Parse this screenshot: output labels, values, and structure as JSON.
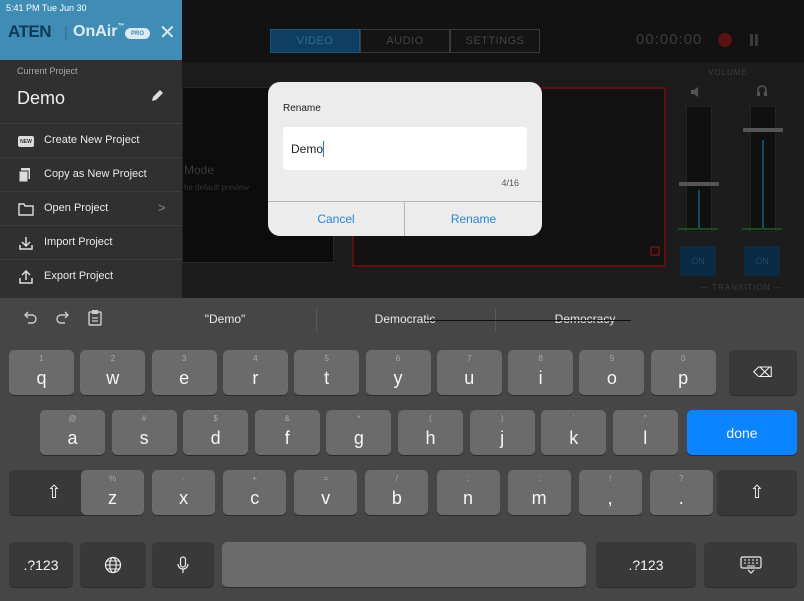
{
  "status_bar": {
    "time": "5:41 PM  Tue Jun 30"
  },
  "app_header": {
    "logo": "ATEN",
    "separator": "|",
    "product": "OnAir",
    "tm": "™",
    "pro_badge": "PRO",
    "close_glyph": "✕",
    "tabs": [
      {
        "label": "VIDEO",
        "active": true
      },
      {
        "label": "AUDIO",
        "active": false
      },
      {
        "label": "SETTINGS",
        "active": false
      }
    ],
    "timer": "00:00:00"
  },
  "sidebar": {
    "current_label": "Current Project",
    "project_name": "Demo",
    "items": [
      {
        "label": "Create New Project",
        "icon": "new-badge-icon",
        "badge": "NEW"
      },
      {
        "label": "Copy as New Project",
        "icon": "copy-icon"
      },
      {
        "label": "Open Project",
        "icon": "folder-icon",
        "chevron": ">"
      },
      {
        "label": "Import Project",
        "icon": "import-icon"
      },
      {
        "label": "Export Project",
        "icon": "export-icon"
      }
    ]
  },
  "background": {
    "mode_text": "Mode",
    "mode_sub": "he default preview",
    "volume_label": "VOLUME",
    "transition_label": "— TRANSITION —",
    "on_left": "ON",
    "on_right": "ON"
  },
  "dialog": {
    "title": "Rename",
    "input_value": "Demo",
    "char_count": "4/16",
    "cancel_label": "Cancel",
    "rename_label": "Rename"
  },
  "keyboard": {
    "predictions": [
      "\"Demo\"",
      "Democratic",
      "Democracy"
    ],
    "row1": [
      {
        "hint": "1",
        "key": "q"
      },
      {
        "hint": "2",
        "key": "w"
      },
      {
        "hint": "3",
        "key": "e"
      },
      {
        "hint": "4",
        "key": "r"
      },
      {
        "hint": "5",
        "key": "t"
      },
      {
        "hint": "6",
        "key": "y"
      },
      {
        "hint": "7",
        "key": "u"
      },
      {
        "hint": "8",
        "key": "i"
      },
      {
        "hint": "9",
        "key": "o"
      },
      {
        "hint": "0",
        "key": "p"
      }
    ],
    "row2": [
      {
        "hint": "@",
        "key": "a"
      },
      {
        "hint": "#",
        "key": "s"
      },
      {
        "hint": "$",
        "key": "d"
      },
      {
        "hint": "&",
        "key": "f"
      },
      {
        "hint": "*",
        "key": "g"
      },
      {
        "hint": "(",
        "key": "h"
      },
      {
        "hint": ")",
        "key": "j"
      },
      {
        "hint": "'",
        "key": "k"
      },
      {
        "hint": "\"",
        "key": "l"
      }
    ],
    "row3": [
      {
        "hint": "%",
        "key": "z"
      },
      {
        "hint": "-",
        "key": "x"
      },
      {
        "hint": "+",
        "key": "c"
      },
      {
        "hint": "=",
        "key": "v"
      },
      {
        "hint": "/",
        "key": "b"
      },
      {
        "hint": ";",
        "key": "n"
      },
      {
        "hint": ":",
        "key": "m"
      },
      {
        "hint": "!",
        "key": ","
      },
      {
        "hint": "?",
        "key": "."
      }
    ],
    "done_label": "done",
    "numbers_label": ".?123",
    "backspace_glyph": "⌫",
    "shift_glyph": "⇧",
    "accent_color": "#0a84ff"
  }
}
